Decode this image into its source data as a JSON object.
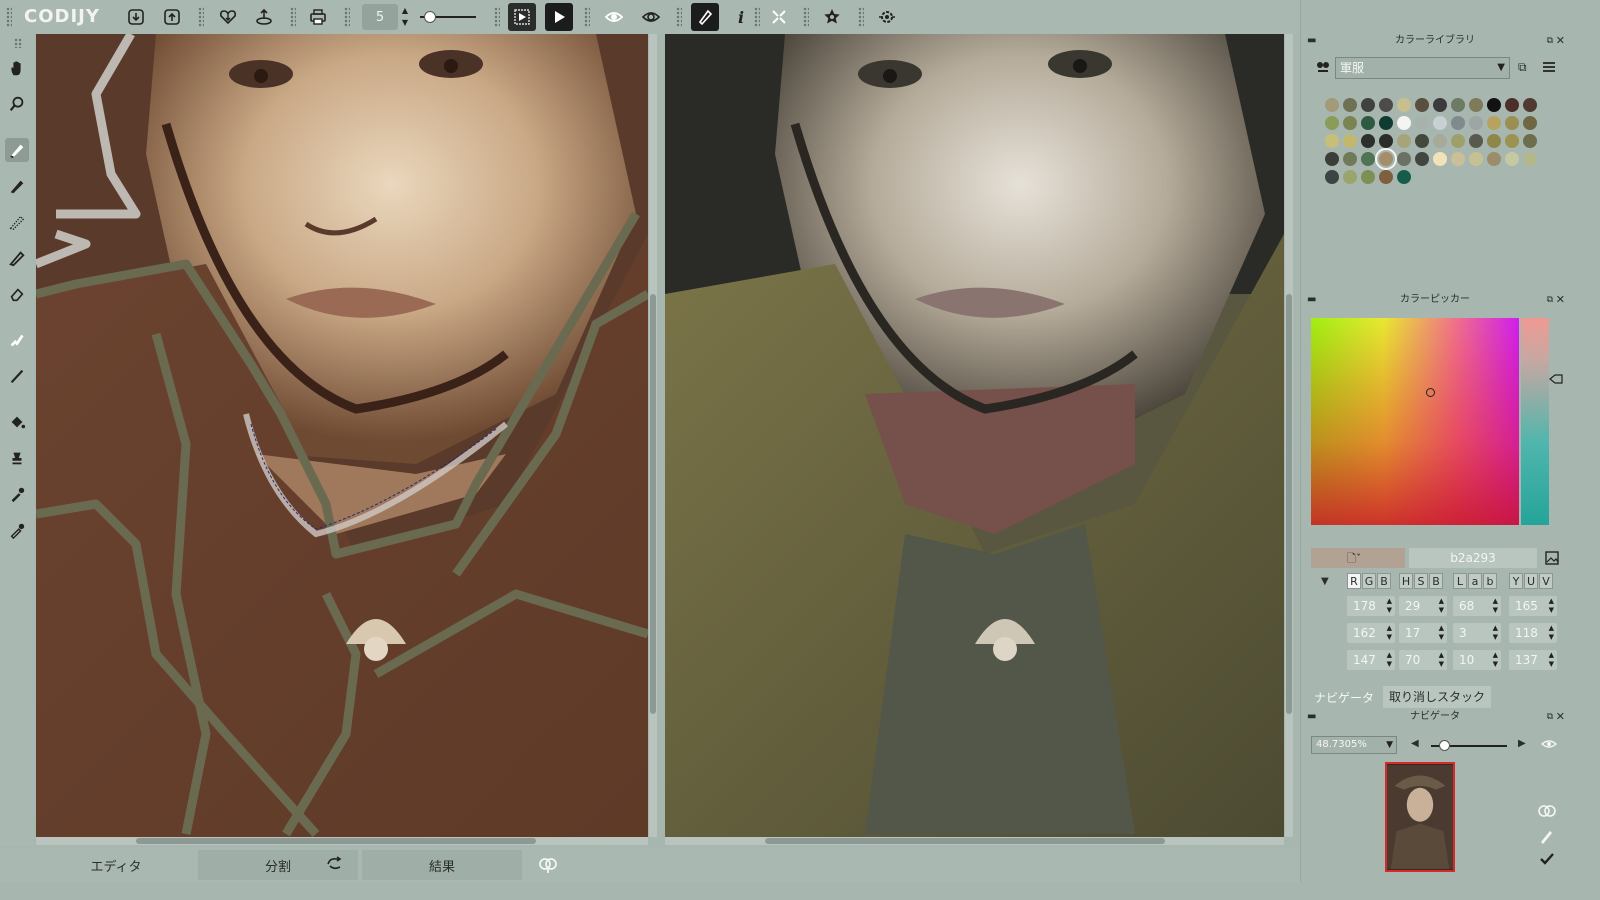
{
  "app": {
    "logo": "CODIJY"
  },
  "toolbar": {
    "brush_size": "5",
    "brush_size_fill": 0.1,
    "icons": [
      "import-icon",
      "export-icon",
      "save-heart-icon",
      "upload-icon",
      "print-icon",
      "film-icon",
      "play-icon",
      "eye-icon",
      "eye-dots-icon",
      "brush-toggle-icon",
      "info-icon",
      "fullscreen-icon",
      "settings-star-icon",
      "gear-icon"
    ]
  },
  "left_tools": [
    "hand-icon",
    "zoom-icon",
    "brush-icon",
    "pen-icon",
    "texture-brush-icon",
    "pencil-icon",
    "eraser-icon",
    "smudge-icon",
    "line-icon",
    "fill-icon",
    "stamp-icon",
    "eyedropper-icon",
    "picker-icon"
  ],
  "bottom_tabs": {
    "editor": "エディタ",
    "split": "分割",
    "result": "結果"
  },
  "color_library": {
    "title": "カラーライブラリ",
    "selected": "軍服",
    "swatches": [
      [
        "#a39a77",
        "#6f7252",
        "#3f423e",
        "#4d4a4a",
        "#c7c08e",
        "#5a4e3e",
        "#3b3b3c",
        "#6d7a64",
        "#7f7a5a",
        "#121212",
        "#4a3028",
        "#4e3a30"
      ],
      [
        "#8a9c57",
        "#7a8452",
        "#2f5a41",
        "#0f3b32",
        "#f4f4f1",
        "#a7b1ad",
        "#c8d0d4",
        "#7f8a8c",
        "#9ea6a4",
        "#b7a35f",
        "#9a8e52",
        "#6e6741"
      ],
      [
        "#c5bf79",
        "#c2b86d",
        "#2c2f2b",
        "#2c2c2a",
        "#a8a47a",
        "#44493d",
        "#a7a999",
        "#9ea06b",
        "#595a4d",
        "#8f8748",
        "#9c9252",
        "#6d6c4c"
      ],
      [
        "#3b3e39",
        "#717a58",
        "#4e7355",
        "#a58d6a",
        "#6a7266",
        "#43463f",
        "#f0e2b9",
        "#c9c098",
        "#c5c192",
        "#9b8d6a",
        "#c4c9a1",
        "#b2b88a"
      ],
      [
        "#3d4444",
        "#9aa56d",
        "#7d8f55",
        "#7f603d",
        "#165c4d"
      ]
    ]
  },
  "color_picker": {
    "title": "カラーピッカー",
    "hex": "b2a293",
    "modes": [
      "R",
      "G",
      "B",
      "H",
      "S",
      "B",
      "L",
      "a",
      "b",
      "Y",
      "U",
      "V"
    ],
    "rows": [
      [
        "178",
        "29",
        "68",
        "165"
      ],
      [
        "162",
        "17",
        "3",
        "118"
      ],
      [
        "147",
        "70",
        "10",
        "137"
      ]
    ]
  },
  "panel_tabs": {
    "navigator": "ナビゲータ",
    "undo": "取り消しスタック"
  },
  "navigator": {
    "title": "ナビゲータ",
    "zoom": "48.7305%",
    "zoom_fill": 0.1
  }
}
